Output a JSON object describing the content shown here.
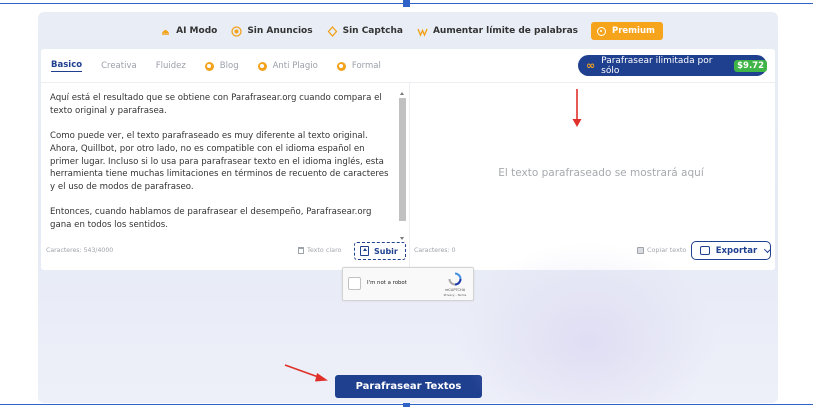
{
  "features": [
    {
      "label": "AI Modo",
      "icon": "sparkle-icon"
    },
    {
      "label": "Sin Anuncios",
      "icon": "no-ads-icon"
    },
    {
      "label": "Sin Captcha",
      "icon": "shield-icon"
    },
    {
      "label": "Aumentar límite de palabras",
      "icon": "bolt-icon"
    }
  ],
  "premium": {
    "label": "Premium",
    "icon": "crown-icon"
  },
  "modes": [
    {
      "label": "Basico",
      "active": true
    },
    {
      "label": "Creativa",
      "active": false
    },
    {
      "label": "Fluidez",
      "active": false
    },
    {
      "label": "Blog",
      "active": false,
      "premium": true
    },
    {
      "label": "Anti Plagio",
      "active": false,
      "premium": true
    },
    {
      "label": "Formal",
      "active": false,
      "premium": true
    }
  ],
  "unlimited": {
    "label": "Parafrasear ilimitada por sólo",
    "price": "$9.72",
    "icon": "infinity-icon"
  },
  "input": {
    "paragraph_1": "Aquí está el resultado que se obtiene con Parafrasear.org cuando compara el texto original y parafrasea.",
    "paragraph_2": "Como puede ver, el texto parafraseado es muy diferente al texto original. Ahora, Quillbot, por otro lado, no es compatible con el idioma español en primer lugar. Incluso si lo usa para parafrasear texto en el idioma inglés, esta herramienta tiene muchas limitaciones en términos de recuento de caracteres y el uso de modos de parafraseo.",
    "paragraph_3": "Entonces, cuando hablamos de parafrasear el desempeño, Parafrasear.org gana en todos los sentidos."
  },
  "input_footer": {
    "chars": "Caracteres: 543/4000",
    "clear_label": "Texto claro",
    "upload_label": "Subir"
  },
  "output": {
    "placeholder": "El texto parafraseado se mostrará aquí"
  },
  "output_footer": {
    "chars": "Caracteres: 0",
    "copy_label": "Copiar texto",
    "export_label": "Exportar"
  },
  "recaptcha": {
    "label": "I'm not a robot",
    "brand": "reCAPTCHA",
    "terms": "Privacy - Terms"
  },
  "submit": {
    "label": "Parafrasear Textos"
  },
  "colors": {
    "primary": "#1f3f8f",
    "accent": "#f7a41d",
    "price_badge": "#3fb447",
    "arrow": "#e0302a"
  }
}
